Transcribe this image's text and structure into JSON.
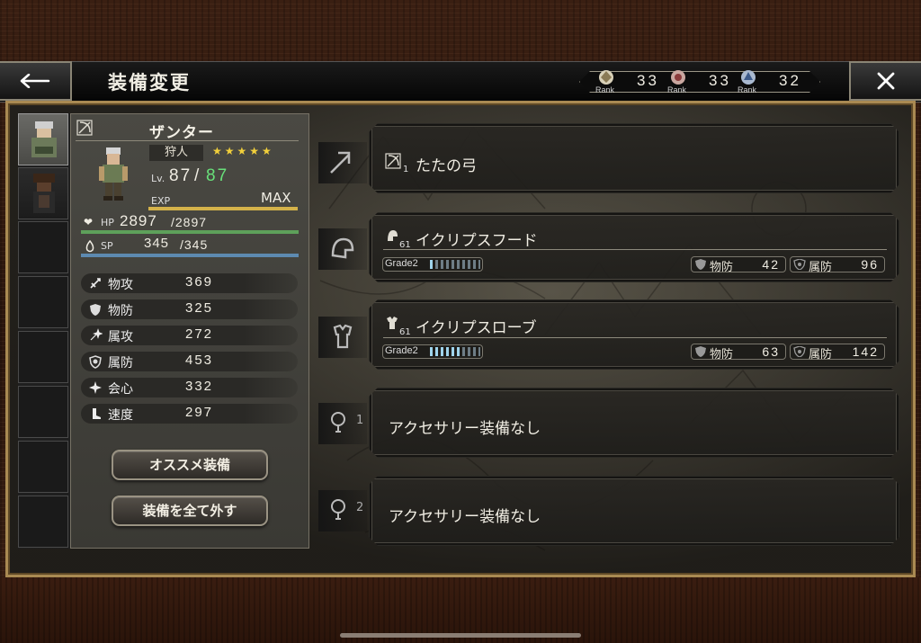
{
  "header": {
    "title": "装備変更",
    "ranks": [
      {
        "label": "Rank",
        "value": "33"
      },
      {
        "label": "Rank",
        "value": "33"
      },
      {
        "label": "Rank",
        "value": "32"
      }
    ]
  },
  "character": {
    "name": "ザンター",
    "job": "狩人",
    "stars": "★★★★★",
    "lv_label": "Lv.",
    "lv_current": "87",
    "lv_slash": "/",
    "lv_max": "87",
    "exp_label": "EXP",
    "exp_status": "MAX",
    "hp_label": "HP",
    "hp_current": "2897",
    "hp_max": "/2897",
    "sp_label": "SP",
    "sp_current": "345",
    "sp_max": "/345",
    "stats": [
      {
        "label": "物攻",
        "value": "369",
        "icon": "physical-attack-icon"
      },
      {
        "label": "物防",
        "value": "325",
        "icon": "physical-defense-icon"
      },
      {
        "label": "属攻",
        "value": "272",
        "icon": "elemental-attack-icon"
      },
      {
        "label": "属防",
        "value": "453",
        "icon": "elemental-defense-icon"
      },
      {
        "label": "会心",
        "value": "332",
        "icon": "critical-icon"
      },
      {
        "label": "速度",
        "value": "297",
        "icon": "speed-icon"
      }
    ]
  },
  "buttons": {
    "recommend": "オススメ装備",
    "unequip_all": "装備を全て外す"
  },
  "equipment": {
    "weapon": {
      "level": "1",
      "name": "たたの弓"
    },
    "head": {
      "level": "61",
      "name": "イクリプスフード",
      "grade_label": "Grade2",
      "grade_fill": 0.1,
      "phys_def_label": "物防",
      "phys_def": "42",
      "elem_def_label": "属防",
      "elem_def": "96"
    },
    "body": {
      "level": "61",
      "name": "イクリプスローブ",
      "grade_label": "Grade2",
      "grade_fill": 0.6,
      "phys_def_label": "物防",
      "phys_def": "63",
      "elem_def_label": "属防",
      "elem_def": "142"
    },
    "accessory1": {
      "slot_number": "1",
      "text": "アクセサリー装備なし"
    },
    "accessory2": {
      "slot_number": "2",
      "text": "アクセサリー装備なし"
    }
  },
  "colors": {
    "hp_bar": "#5ea05a",
    "sp_bar": "#5d8ab0",
    "exp_bar": "#d4b24a",
    "level_max": "#68e07a",
    "stars": "#f2d03b",
    "frame_gold": "#a98a52"
  }
}
